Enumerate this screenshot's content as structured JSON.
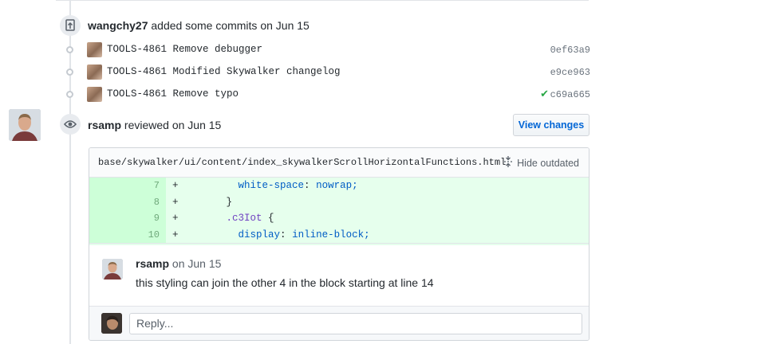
{
  "commits_event": {
    "author": "wangchy27",
    "action": "added some commits on Jun 15",
    "commits": [
      {
        "message": "TOOLS-4861 Remove debugger",
        "sha": "0ef63a9",
        "verified": false
      },
      {
        "message": "TOOLS-4861 Modified Skywalker changelog",
        "sha": "e9ce963",
        "verified": false
      },
      {
        "message": "TOOLS-4861 Remove typo",
        "sha": "c69a665",
        "verified": true
      }
    ]
  },
  "review_event": {
    "author": "rsamp",
    "action": "reviewed on Jun 15",
    "view_changes_label": "View changes",
    "file_path": "base/skywalker/ui/content/index_skywalkerScrollHorizontalFunctions.html",
    "hide_outdated_label": "Hide outdated",
    "diff_lines": [
      {
        "line": "7",
        "sign": "+",
        "indent": "          ",
        "prop": "white-space",
        "value": "nowrap;"
      },
      {
        "line": "8",
        "sign": "+",
        "indent": "        ",
        "text": "}"
      },
      {
        "line": "9",
        "sign": "+",
        "indent": "        ",
        "selector": ".c3Iot",
        "brace": " {"
      },
      {
        "line": "10",
        "sign": "+",
        "indent": "          ",
        "prop": "display",
        "value": "inline-block;"
      }
    ],
    "comment": {
      "author": "rsamp",
      "date": "on Jun 15",
      "body": "this styling can join the other 4 in the block starting at line 14"
    },
    "reply_placeholder": "Reply..."
  },
  "icons": {
    "push": "repo-push-icon",
    "eye": "eye-icon",
    "fold": "fold-icon",
    "check": "check-icon"
  },
  "colors": {
    "link": "#0366d6",
    "added_bg": "#e6ffed",
    "added_gutter": "#cdffd8",
    "success": "#28a745"
  }
}
